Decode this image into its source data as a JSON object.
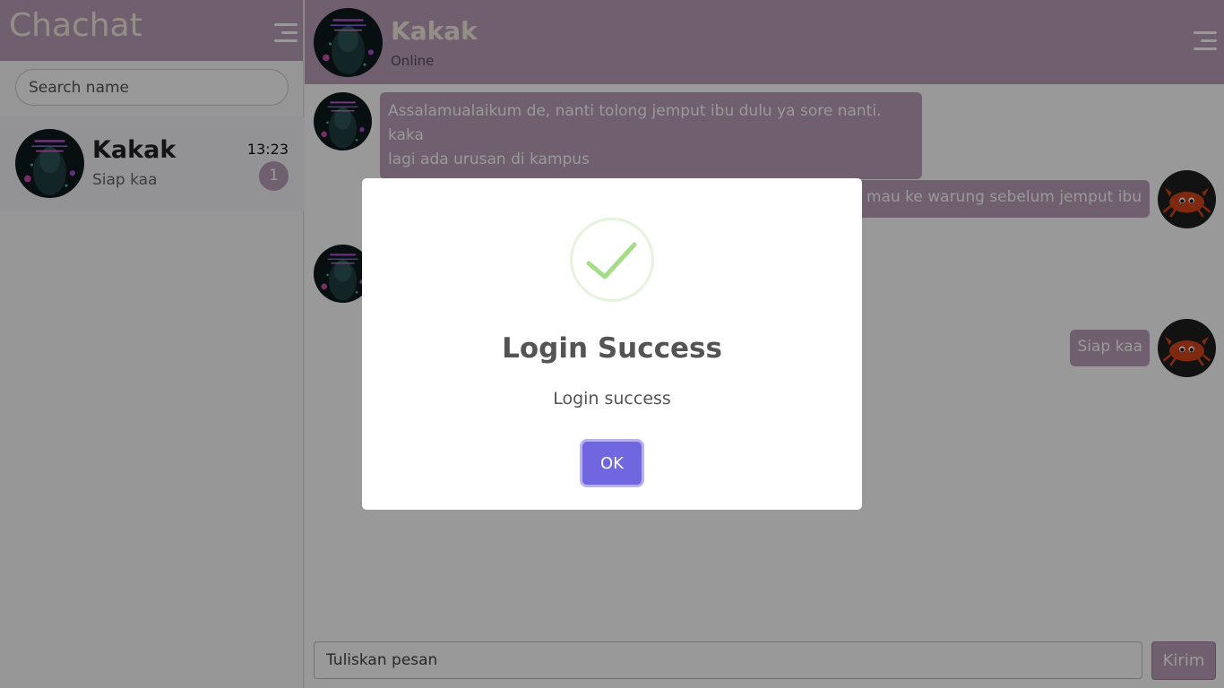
{
  "sidebar": {
    "app_title": "Chachat",
    "search_placeholder": "Search name",
    "contacts": [
      {
        "name": "Kakak",
        "last_message": "Siap kaa",
        "time": "13:23",
        "unread": "1"
      }
    ]
  },
  "chat": {
    "contact_name": "Kakak",
    "status": "Online",
    "messages": [
      {
        "from": "contact",
        "line1": "Assalamualaikum de, nanti tolong jemput ibu dulu ya sore nanti. kaka",
        "line2": "lagi ada urusan di kampus"
      },
      {
        "from": "me",
        "text": "u mau ke warung sebelum jemput ibu"
      },
      {
        "from": "me",
        "text": "Siap kaa"
      }
    ],
    "input_placeholder": "Tuliskan pesan",
    "send_label": "Kirim"
  },
  "modal": {
    "title": "Login Success",
    "text": "Login success",
    "ok_label": "OK"
  },
  "colors": {
    "accent": "#b99fb9",
    "header_text": "#f6efe2",
    "ok_button": "#7066e0",
    "success_green": "#a5dc86"
  },
  "icons": {
    "menu": "hamburger-menu-icon",
    "success": "checkmark-circle-icon"
  }
}
